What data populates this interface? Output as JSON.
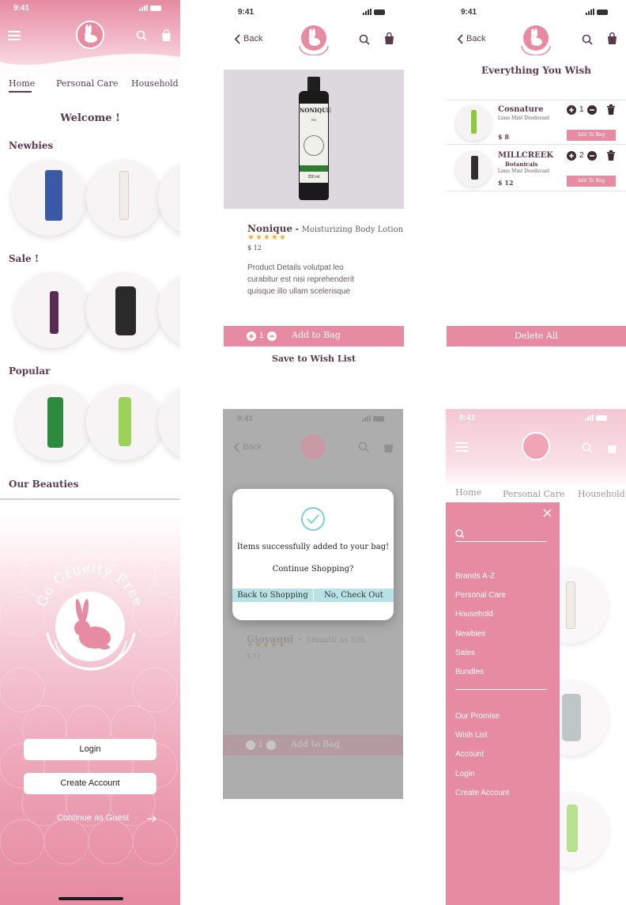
{
  "status": {
    "time": "9:41"
  },
  "colors": {
    "pink": "#e68ba1",
    "plum": "#5a3a4c",
    "teal": "#b8e3e6",
    "star": "#f2b13a"
  },
  "home": {
    "tabs": [
      "Home",
      "Personal Care",
      "Household"
    ],
    "welcome": "Welcome !",
    "sections": [
      "Newbies",
      "Sale !",
      "Popular",
      "Our Beauties"
    ]
  },
  "product": {
    "back": "Back",
    "brand": "Nonique",
    "dash": "-",
    "name": "Moisturizing Body Lotion",
    "rating": 5,
    "price": "$ 12",
    "details": [
      "Product Details volutpat leo",
      "curabitur est nisi reprehenderit",
      "quisque illo ullam scelerisque"
    ],
    "qty": "1",
    "add_to_bag": "Add to Bag",
    "wishlist": "Save to Wish List",
    "label_brand": "NONIQUE",
    "label_sub": "RW",
    "label_vol": "250 ml"
  },
  "wishlist": {
    "back": "Back",
    "title": "Everything You Wish",
    "items": [
      {
        "brand": "Cosnature",
        "brand2": "",
        "desc": "Lime Mint Deodorant",
        "price": "$ 8",
        "qty": "1",
        "button": "Add To Bag"
      },
      {
        "brand": "MILLCREEK",
        "brand2": "Botanicals",
        "desc": "Lime Mint Deodorant",
        "price": "$ 12",
        "qty": "2",
        "button": "Add To Bag"
      }
    ],
    "delete_all": "Delete All"
  },
  "splash": {
    "tagline": "Go Cruelty Free",
    "login": "Login",
    "create": "Create Account",
    "guest": "Continue as Guest"
  },
  "modal": {
    "back": "Back",
    "message": "Items successfully added to your bag!",
    "question": "Continue Shopping?",
    "btn_back": "Back to Shopping",
    "btn_checkout": "No, Check Out",
    "bg_brand": "Giovanni",
    "bg_dash": "-",
    "bg_name": "Smooth as Silk",
    "bg_price": "$ 12",
    "bg_qty": "1",
    "bg_add": "Add to Bag"
  },
  "menu": {
    "tabs": [
      "Home",
      "Personal Care",
      "Household"
    ],
    "group1": [
      "Brands A-Z",
      "Personal Care",
      "Household",
      "Newbies",
      "Sales",
      "Bundles"
    ],
    "group2": [
      "Our Promise",
      "Wish List",
      "Account",
      "Login",
      "Create Account"
    ]
  }
}
